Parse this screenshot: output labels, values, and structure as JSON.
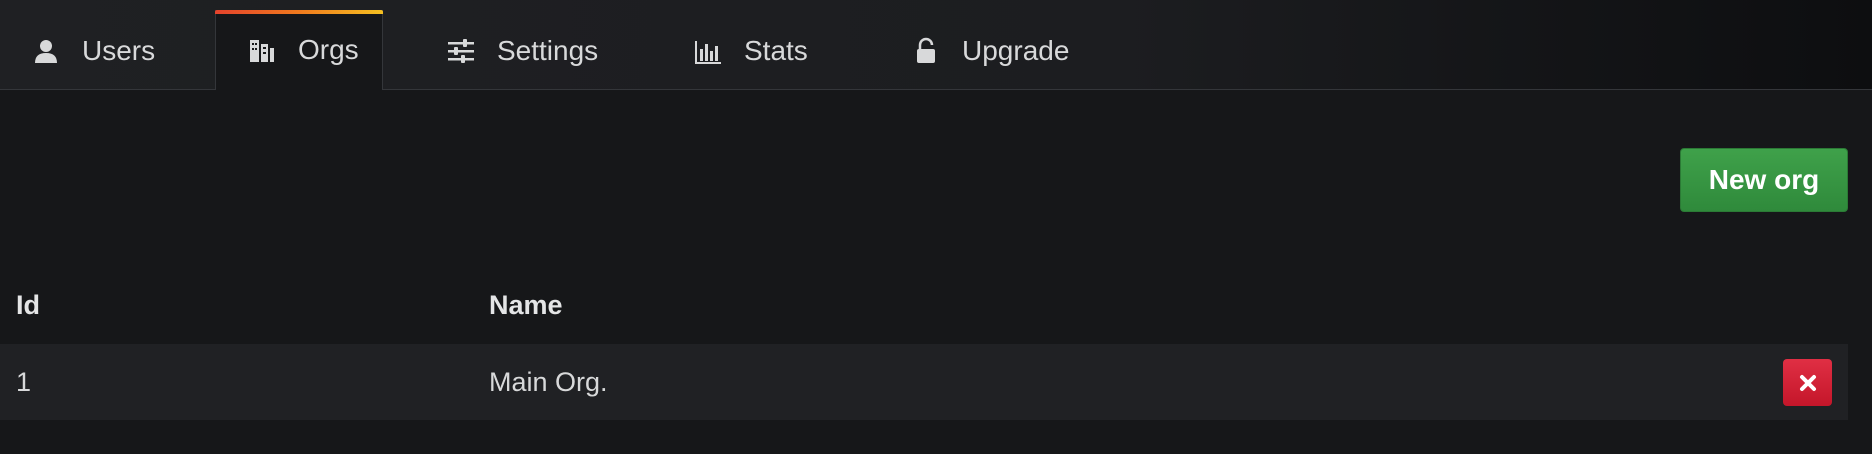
{
  "tabs": [
    {
      "label": "Users",
      "icon": "user-icon",
      "active": false
    },
    {
      "label": "Orgs",
      "icon": "building-icon",
      "active": true
    },
    {
      "label": "Settings",
      "icon": "sliders-icon",
      "active": false
    },
    {
      "label": "Stats",
      "icon": "bar-chart-icon",
      "active": false
    },
    {
      "label": "Upgrade",
      "icon": "unlock-icon",
      "active": false
    }
  ],
  "toolbar": {
    "new_org_label": "New org"
  },
  "table": {
    "columns": [
      "Id",
      "Name"
    ],
    "rows": [
      {
        "id": "1",
        "name": "Main Org."
      }
    ]
  },
  "colors": {
    "active_tab_accent": "#f07a1e",
    "primary_button": "#3fa14a",
    "danger_button": "#e02f44",
    "background": "#161719"
  }
}
